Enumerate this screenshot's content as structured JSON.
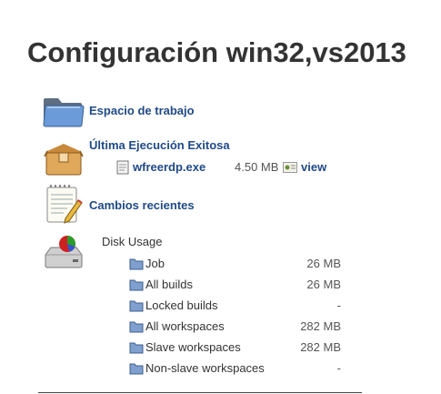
{
  "title": "Configuración win32,vs2013",
  "workspace": {
    "label": "Espacio de trabajo",
    "icon": "folder-icon"
  },
  "last_success": {
    "label": "Última Ejecución Exitosa",
    "icon": "package-icon",
    "artifact": {
      "file_name": "wfreerdp.exe",
      "size": "4.50 MB",
      "view_label": "view"
    }
  },
  "changes": {
    "label": "Cambios recientes",
    "icon": "notepad-icon"
  },
  "disk_usage": {
    "title": "Disk Usage",
    "icon": "hard-disk-icon",
    "rows": [
      {
        "name": "Job",
        "value": "26 MB"
      },
      {
        "name": "All builds",
        "value": "26 MB"
      },
      {
        "name": "Locked builds",
        "value": "-"
      },
      {
        "name": "All workspaces",
        "value": "282 MB"
      },
      {
        "name": "Slave workspaces",
        "value": "282 MB"
      },
      {
        "name": "Non-slave workspaces",
        "value": "-"
      }
    ]
  },
  "colors": {
    "link": "#204a87",
    "text": "#333333",
    "folder": "#6b8fc4"
  }
}
